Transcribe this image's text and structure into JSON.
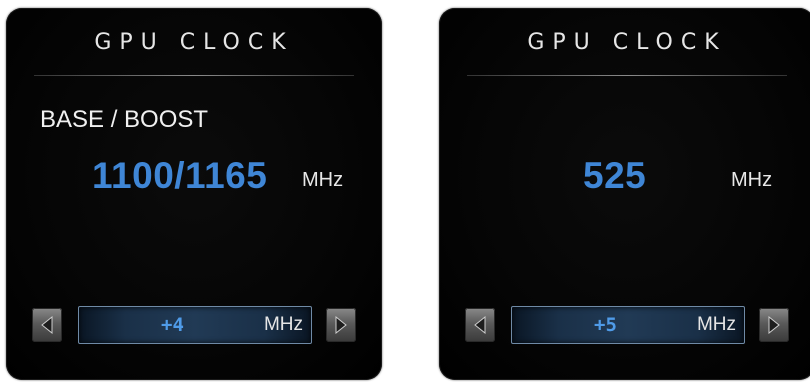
{
  "panels": [
    {
      "title": "GPU CLOCK",
      "mode_label": "BASE / BOOST",
      "clock_value": "1100/1165",
      "clock_unit": "MHz",
      "offset_value": "+4",
      "offset_unit": "MHz",
      "decrement_icon": "arrow-left-icon",
      "increment_icon": "arrow-right-icon"
    },
    {
      "title": "GPU CLOCK",
      "mode_label": "",
      "clock_value": "525",
      "clock_unit": "MHz",
      "offset_value": "+5",
      "offset_unit": "MHz",
      "decrement_icon": "arrow-left-icon",
      "increment_icon": "arrow-right-icon"
    }
  ],
  "colors": {
    "accent_blue": "#3f86d6",
    "panel_background": "#050505",
    "label_text": "#f0f0f0"
  }
}
